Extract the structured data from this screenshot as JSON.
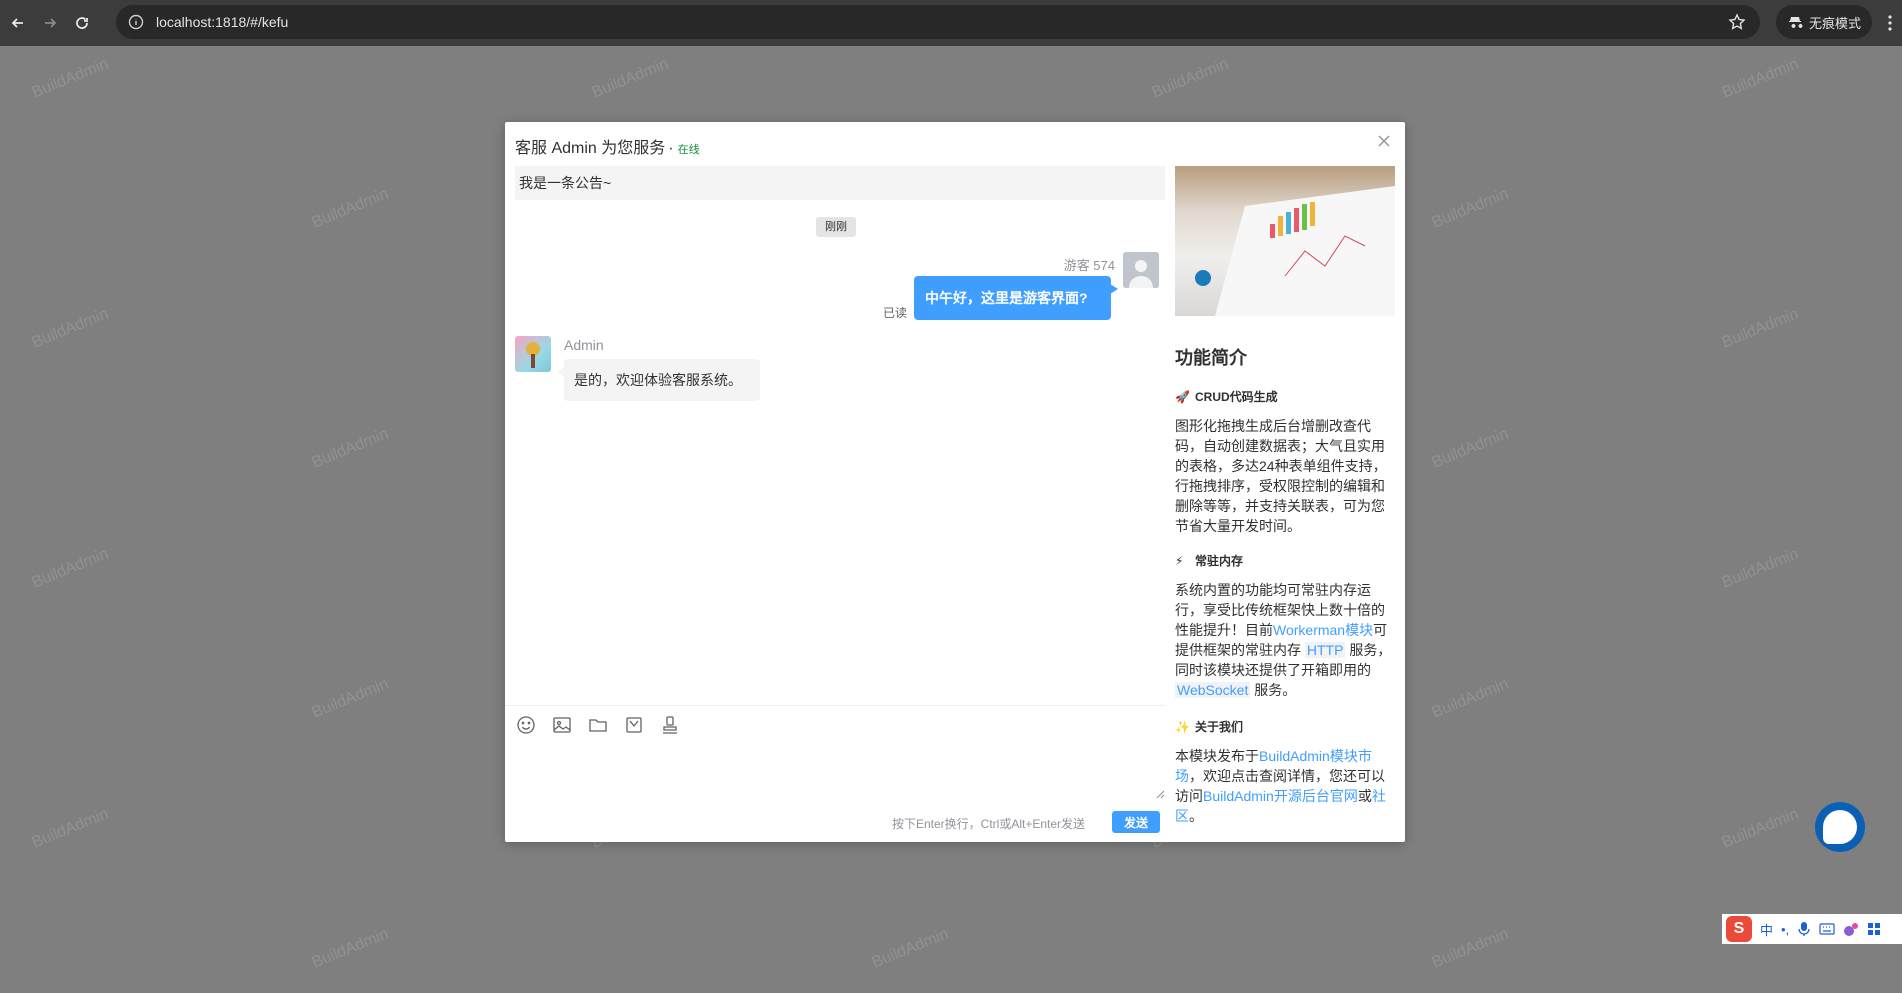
{
  "browser": {
    "url": "localhost:1818/#/kefu",
    "incognito_label": "无痕模式"
  },
  "watermark_text": "BuildAdmin",
  "dialog": {
    "title": "客服 Admin 为您服务",
    "title_dot": "·",
    "status": "在线",
    "notice": "我是一条公告~",
    "time_chip": "刚刚",
    "visitor_name": "游客 574",
    "visitor_message": "中午好，这里是游客界面?",
    "read_status": "已读",
    "admin_name": "Admin",
    "admin_message": "是的，欢迎体验客服系统。",
    "input_hint": "按下Enter换行，Ctrl或Alt+Enter发送",
    "send_label": "发送"
  },
  "panel": {
    "title": "功能简介",
    "sections": [
      {
        "emoji": "🚀",
        "heading": "CRUD代码生成",
        "body": "图形化拖拽生成后台增删改查代码，自动创建数据表；大气且实用的表格，多达24种表单组件支持，行拖拽排序，受权限控制的编辑和删除等等，并支持关联表，可为您节省大量开发时间。"
      },
      {
        "emoji": "⚡",
        "heading": "常驻内存",
        "body_1": "系统内置的功能均可常驻内存运行，享受比传统框架快上数十倍的性能提升！目前",
        "link_1": "Workerman模块",
        "body_2": "可提供框架的常驻内存 ",
        "link_2": "HTTP",
        "body_3": " 服务，同时该模块还提供了开箱即用的 ",
        "link_3": "WebSocket",
        "body_4": " 服务。"
      },
      {
        "emoji": "✨",
        "heading": "关于我们",
        "body_1": "本模块发布于",
        "link_1": "BuildAdmin模块市场",
        "body_2": "，欢迎点击查阅详情，您还可以访问",
        "link_2": "BuildAdmin开源后台官网",
        "body_3": "或",
        "link_3": "社区",
        "body_4": "。"
      }
    ]
  },
  "ime": {
    "mode": "中",
    "punct": "•,"
  }
}
